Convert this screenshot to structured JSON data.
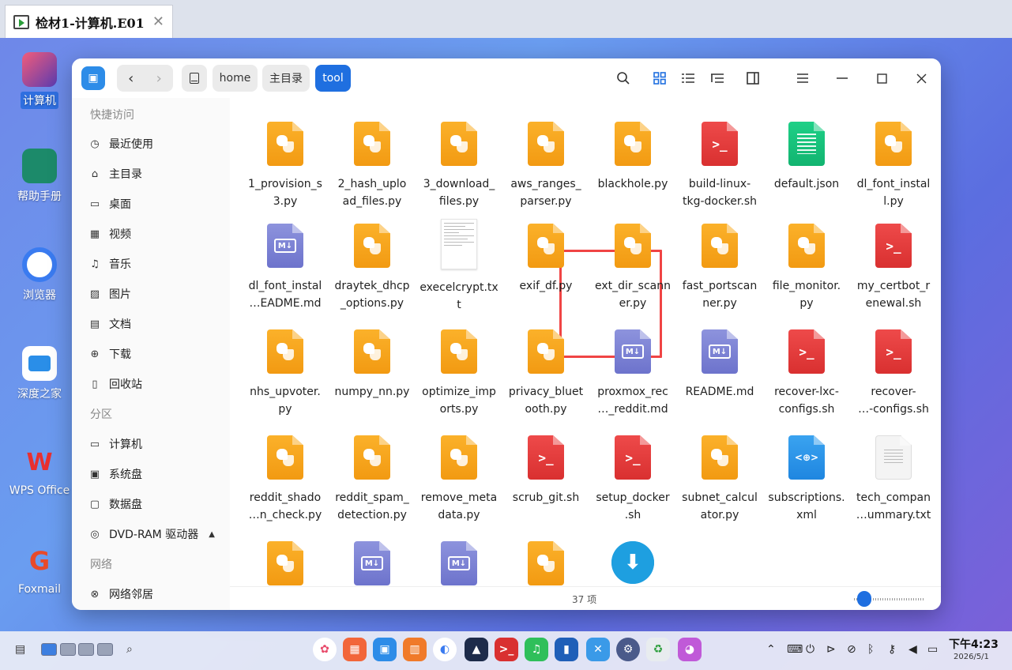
{
  "vm_tab": {
    "title": "检材1-计算机.E01",
    "close": "✕"
  },
  "desktop_icons": [
    {
      "label": "计算机"
    },
    {
      "label": "帮助手册"
    },
    {
      "label": "浏览器"
    },
    {
      "label": "深度之家"
    },
    {
      "label": "WPS Office"
    },
    {
      "label": "Foxmail"
    }
  ],
  "window": {
    "breadcrumbs": [
      "home",
      "主目录",
      "tool"
    ],
    "toolbar_icons": [
      "search-icon",
      "icon-view-icon",
      "list-view-icon",
      "tree-view-icon",
      "details-panel-icon",
      "menu-icon",
      "minimize-icon",
      "maximize-icon",
      "close-icon"
    ],
    "nav_back": "‹",
    "nav_forward": "›"
  },
  "sidebar": {
    "quick_access_title": "快捷访问",
    "quick_access": [
      {
        "label": "最近使用",
        "icon": "clock-icon"
      },
      {
        "label": "主目录",
        "icon": "home-icon"
      },
      {
        "label": "桌面",
        "icon": "desktop-icon"
      },
      {
        "label": "视频",
        "icon": "video-icon"
      },
      {
        "label": "音乐",
        "icon": "music-icon"
      },
      {
        "label": "图片",
        "icon": "picture-icon"
      },
      {
        "label": "文档",
        "icon": "document-icon"
      },
      {
        "label": "下载",
        "icon": "download-icon"
      },
      {
        "label": "回收站",
        "icon": "trash-icon"
      }
    ],
    "partitions_title": "分区",
    "partitions": [
      {
        "label": "计算机",
        "icon": "computer-icon"
      },
      {
        "label": "系统盘",
        "icon": "system-disk-icon"
      },
      {
        "label": "数据盘",
        "icon": "data-disk-icon"
      },
      {
        "label": "DVD-RAM 驱动器",
        "icon": "dvd-icon"
      }
    ],
    "network_title": "网络",
    "network": [
      {
        "label": "网络邻居",
        "icon": "network-icon"
      }
    ]
  },
  "files": [
    {
      "name": "1_provision_s\n3.py",
      "type": "py"
    },
    {
      "name": "2_hash_uplo\nad_files.py",
      "type": "py"
    },
    {
      "name": "3_download_\nfiles.py",
      "type": "py"
    },
    {
      "name": "aws_ranges_\nparser.py",
      "type": "py"
    },
    {
      "name": "blackhole.py",
      "type": "py"
    },
    {
      "name": "build-linux-\ntkg-docker.sh",
      "type": "sh"
    },
    {
      "name": "default.json",
      "type": "json"
    },
    {
      "name": "dl_font_instal\nl.py",
      "type": "py"
    },
    {
      "name": "dl_font_instal\n…EADME.md",
      "type": "md"
    },
    {
      "name": "draytek_dhcp\n_options.py",
      "type": "py"
    },
    {
      "name": "execelcrypt.tx\nt",
      "type": "preview"
    },
    {
      "name": "exif_df.py",
      "type": "py"
    },
    {
      "name": "ext_dir_scann\ner.py",
      "type": "py"
    },
    {
      "name": "fast_portscan\nner.py",
      "type": "py"
    },
    {
      "name": "file_monitor.\npy",
      "type": "py"
    },
    {
      "name": "my_certbot_r\nenewal.sh",
      "type": "sh"
    },
    {
      "name": "nhs_upvoter.\npy",
      "type": "py"
    },
    {
      "name": "numpy_nn.py",
      "type": "py"
    },
    {
      "name": "optimize_imp\norts.py",
      "type": "py"
    },
    {
      "name": "privacy_bluet\nooth.py",
      "type": "py"
    },
    {
      "name": "proxmox_rec\n…_reddit.md",
      "type": "md"
    },
    {
      "name": "README.md",
      "type": "md"
    },
    {
      "name": "recover-lxc-\nconfigs.sh",
      "type": "sh"
    },
    {
      "name": "recover-\n…-configs.sh",
      "type": "sh"
    },
    {
      "name": "reddit_shado\n…n_check.py",
      "type": "py"
    },
    {
      "name": "reddit_spam_\ndetection.py",
      "type": "py"
    },
    {
      "name": "remove_meta\ndata.py",
      "type": "py"
    },
    {
      "name": "scrub_git.sh",
      "type": "sh"
    },
    {
      "name": "setup_docker\n.sh",
      "type": "sh"
    },
    {
      "name": "subnet_calcul\nator.py",
      "type": "py"
    },
    {
      "name": "subscriptions.\nxml",
      "type": "xml"
    },
    {
      "name": "tech_compan\n…ummary.txt",
      "type": "txt"
    },
    {
      "name": "",
      "type": "py"
    },
    {
      "name": "",
      "type": "md"
    },
    {
      "name": "",
      "type": "md"
    },
    {
      "name": "",
      "type": "py"
    },
    {
      "name": "",
      "type": "gear"
    }
  ],
  "status": {
    "count": "37 项"
  },
  "taskbar": {
    "clock_time": "下午4:23",
    "clock_date": "2026/5/1"
  },
  "colors": {
    "accent": "#1f6fe0",
    "highlight_box": "#f04444",
    "python": "#f4a31a",
    "shell": "#e03a3a",
    "markdown": "#7b80d4"
  }
}
